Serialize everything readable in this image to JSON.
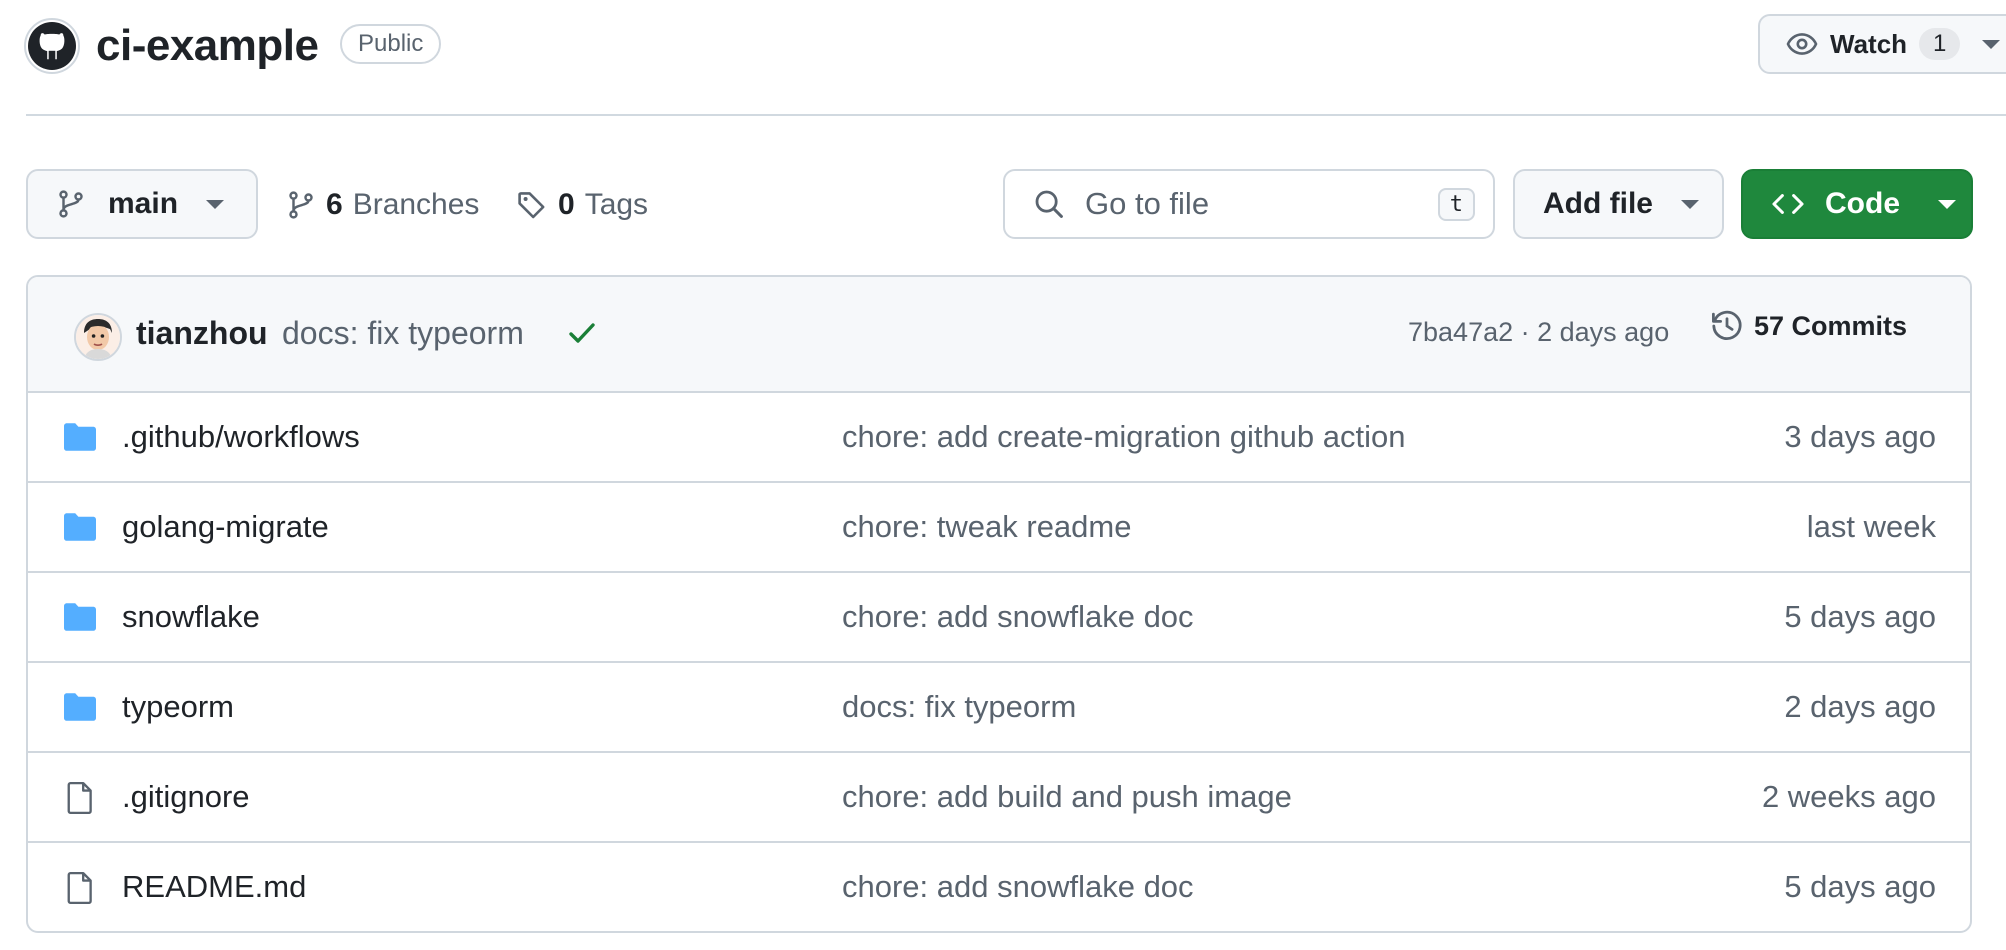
{
  "repo": {
    "name": "ci-example",
    "visibility": "Public",
    "owner_avatar_icon": "octocat-icon"
  },
  "watch": {
    "label": "Watch",
    "count": "1"
  },
  "toolbar": {
    "branch": "main",
    "branches_count": "6",
    "branches_label": "Branches",
    "tags_count": "0",
    "tags_label": "Tags",
    "search_placeholder": "Go to file",
    "search_shortcut": "t",
    "add_file_label": "Add file",
    "code_label": "Code"
  },
  "latest_commit": {
    "author": "tianzhou",
    "message": "docs: fix typeorm",
    "status": "success",
    "meta": "7ba47a2 · 2 days ago",
    "commits_label": "57 Commits"
  },
  "files": [
    {
      "type": "dir",
      "name": ".github/workflows",
      "message": "chore: add create-migration github action",
      "time": "3 days ago"
    },
    {
      "type": "dir",
      "name": "golang-migrate",
      "message": "chore: tweak readme",
      "time": "last week"
    },
    {
      "type": "dir",
      "name": "snowflake",
      "message": "chore: add snowflake doc",
      "time": "5 days ago"
    },
    {
      "type": "dir",
      "name": "typeorm",
      "message": "docs: fix typeorm",
      "time": "2 days ago"
    },
    {
      "type": "file",
      "name": ".gitignore",
      "message": "chore: add build and push image",
      "time": "2 weeks ago"
    },
    {
      "type": "file",
      "name": "README.md",
      "message": "chore: add snowflake doc",
      "time": "5 days ago"
    }
  ],
  "colors": {
    "accent_green": "#1f883d",
    "folder_blue": "#54aeff",
    "muted_text": "#59636e",
    "border": "#d0d7de"
  }
}
